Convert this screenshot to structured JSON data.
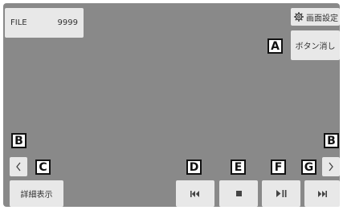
{
  "file": {
    "label": "FILE",
    "number": "9999"
  },
  "top_right": {
    "screen_settings_label": "画面設定",
    "hide_buttons_label": "ボタン消し"
  },
  "bottom": {
    "details_label": "詳細表示"
  },
  "callouts": {
    "a": "A",
    "b": "B",
    "c": "C",
    "d": "D",
    "e": "E",
    "f": "F",
    "g": "G"
  },
  "icons": {
    "settings": "gear-icon",
    "prev_arrow": "chevron-left-icon",
    "next_arrow": "chevron-right-icon",
    "prev_track": "skip-previous-icon",
    "stop": "stop-icon",
    "play_pause": "play-pause-icon",
    "next_track": "skip-next-icon"
  },
  "colors": {
    "screen_bg": "#898989",
    "button_bg": "#e8e8e8",
    "callout_border": "#111111"
  }
}
